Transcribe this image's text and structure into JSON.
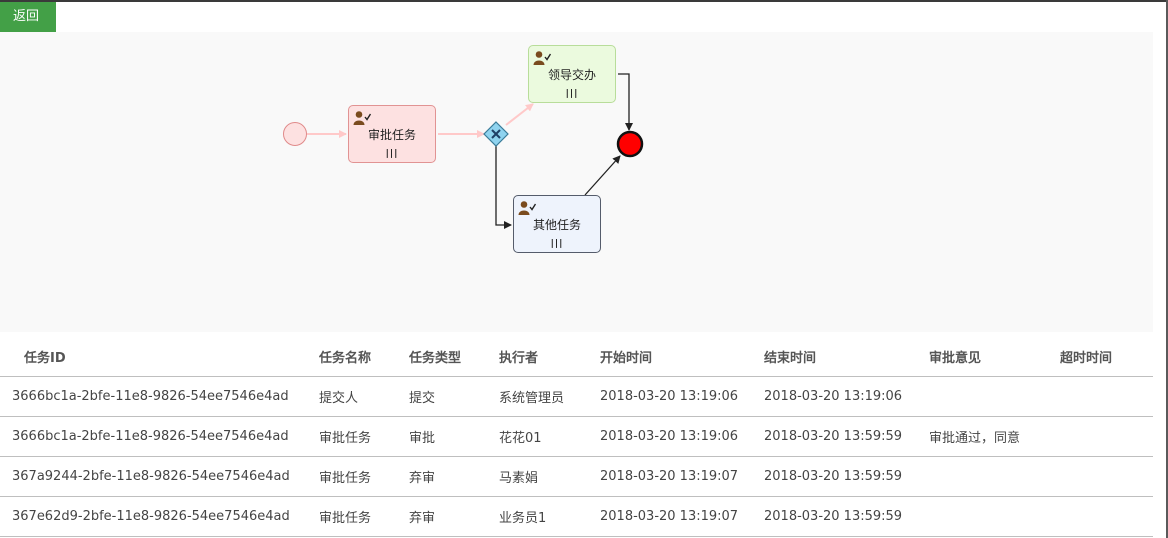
{
  "toolbar": {
    "back_label": "返回"
  },
  "diagram": {
    "tasks": [
      {
        "id": "approve",
        "label": "审批任务",
        "color": "#fde1e1"
      },
      {
        "id": "leader",
        "label": "领导交办",
        "color": "#ebfade"
      },
      {
        "id": "other",
        "label": "其他任务",
        "color": "#eef3fc"
      }
    ],
    "icons": {
      "assignee": "user-check-icon",
      "multi_instance": "parallel-multi-instance-icon",
      "gateway": "exclusive-gateway-icon"
    },
    "colors": {
      "start_event": "#fde1e1",
      "end_event": "#ff0000",
      "highlight_flow": "#ffc9c9",
      "flow": "#222222"
    }
  },
  "table": {
    "columns": [
      "任务ID",
      "任务名称",
      "任务类型",
      "执行者",
      "开始时间",
      "结束时间",
      "审批意见",
      "超时时间"
    ],
    "rows": [
      [
        "3666bc1a-2bfe-11e8-9826-54ee7546e4ad",
        "提交人",
        "提交",
        "系统管理员",
        "2018-03-20 13:19:06",
        "2018-03-20 13:19:06",
        "",
        ""
      ],
      [
        "3666bc1a-2bfe-11e8-9826-54ee7546e4ad",
        "审批任务",
        "审批",
        "花花01",
        "2018-03-20 13:19:06",
        "2018-03-20 13:59:59",
        "审批通过，同意",
        ""
      ],
      [
        "367a9244-2bfe-11e8-9826-54ee7546e4ad",
        "审批任务",
        "弃审",
        "马素娟",
        "2018-03-20 13:19:07",
        "2018-03-20 13:59:59",
        "",
        ""
      ],
      [
        "367e62d9-2bfe-11e8-9826-54ee7546e4ad",
        "审批任务",
        "弃审",
        "业务员1",
        "2018-03-20 13:19:07",
        "2018-03-20 13:59:59",
        "",
        ""
      ]
    ]
  }
}
